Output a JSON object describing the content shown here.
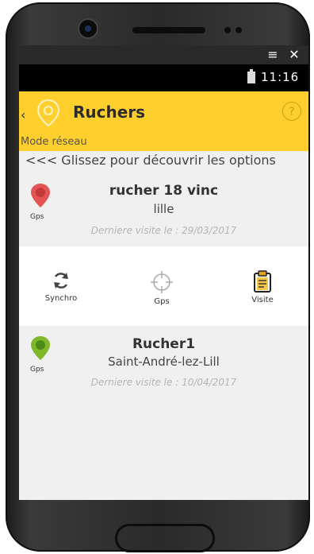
{
  "window": {
    "menu_icon": "menu-icon",
    "close_icon": "close-icon"
  },
  "status": {
    "time": "11:16",
    "battery_icon": "battery-icon"
  },
  "appbar": {
    "back_icon": "chevron-left-icon",
    "title": "Ruchers",
    "help_label": "?"
  },
  "mode": "Mode réseau",
  "hint": "<<< Glissez pour découvrir les options",
  "ruchers": [
    {
      "name": "rucher 18 vinc",
      "city": "lille",
      "visit": "Derniere visite le : 29/03/2017",
      "gps_label": "Gps",
      "marker_color": "#e45454"
    },
    {
      "name": "Rucher1",
      "city": "Saint-André-lez-Lill",
      "visit": "Derniere visite le : 10/04/2017",
      "gps_label": "Gps",
      "marker_color": "#7fb82a"
    }
  ],
  "actions": [
    {
      "label": "Synchro",
      "icon": "sync-icon"
    },
    {
      "label": "Gps",
      "icon": "crosshair-icon"
    },
    {
      "label": "Visite",
      "icon": "clipboard-icon"
    }
  ],
  "colors": {
    "accent": "#ffcf2e",
    "row_bg": "#f0f0f0",
    "status_bg": "#000000"
  }
}
